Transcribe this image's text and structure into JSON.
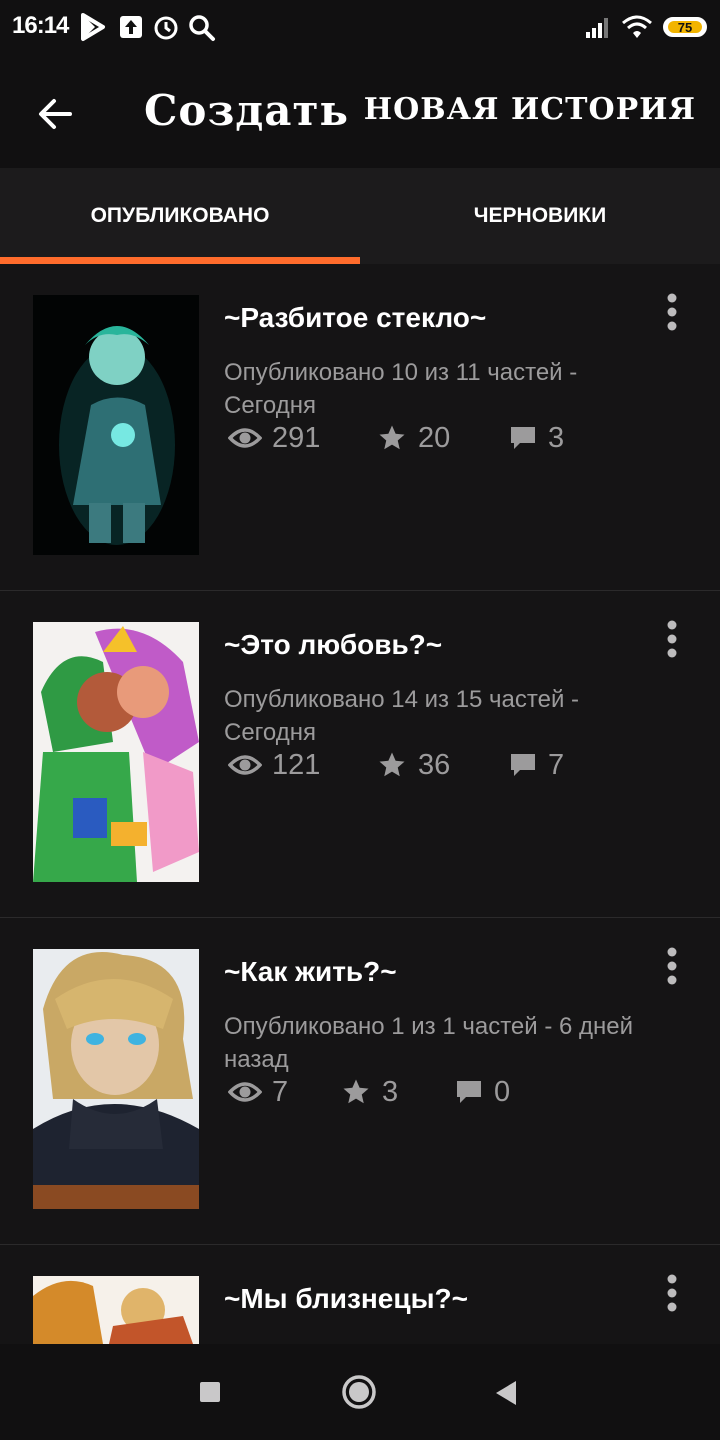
{
  "status_bar": {
    "time": "16:14",
    "icons": [
      "play-store-icon",
      "upload-icon",
      "alarm-icon",
      "search-icon",
      "signal-icon",
      "wifi-icon"
    ],
    "battery": "75"
  },
  "app_bar": {
    "title": "Создать",
    "action": "НОВАЯ ИСТОРИЯ"
  },
  "tabs": [
    {
      "label": "ОПУБЛИКОВАНО",
      "active": true
    },
    {
      "label": "ЧЕРНОВИКИ",
      "active": false
    }
  ],
  "accent_color": "#ff6c2c",
  "stories": [
    {
      "title": "~Разбитое стекло~",
      "meta": "Опубликовано 10 из 11 частей - Сегодня",
      "views": "291",
      "votes": "20",
      "comments": "3"
    },
    {
      "title": "~Это любовь?~",
      "meta": "Опубликовано 14 из 15 частей - Сегодня",
      "views": "121",
      "votes": "36",
      "comments": "7"
    },
    {
      "title": "~Как жить?~",
      "meta": "Опубликовано 1 из 1 частей - 6 дней назад",
      "views": "7",
      "votes": "3",
      "comments": "0"
    },
    {
      "title": "~Мы близнецы?~",
      "meta": "",
      "views": "",
      "votes": "",
      "comments": ""
    }
  ]
}
